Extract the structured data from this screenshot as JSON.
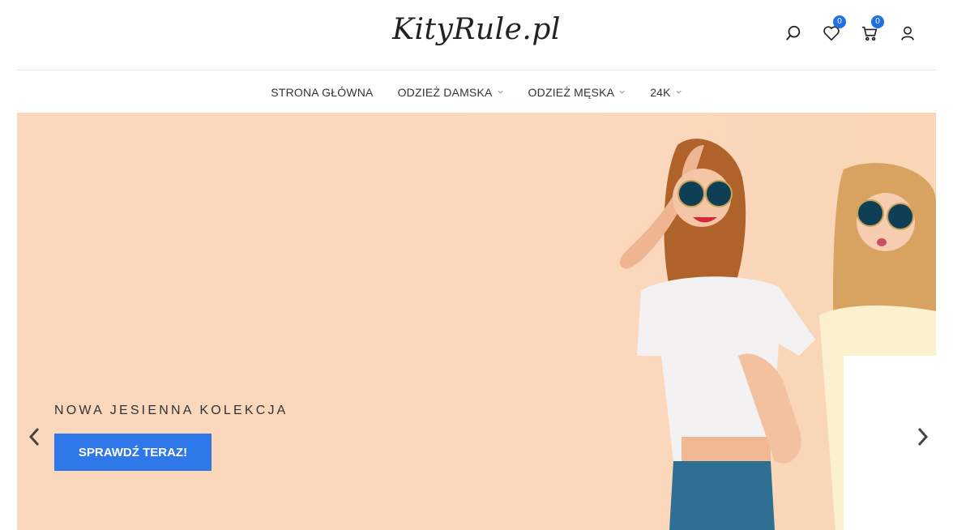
{
  "header": {
    "logo_text": "KityRule.pl",
    "wishlist_count": "0",
    "cart_count": "0"
  },
  "nav": {
    "items": [
      {
        "label": "STRONA GŁÓWNA",
        "dropdown": false
      },
      {
        "label": "ODZIEŻ DAMSKA",
        "dropdown": true
      },
      {
        "label": "ODZIEŻ MĘSKA",
        "dropdown": true
      },
      {
        "label": "24K",
        "dropdown": true
      }
    ]
  },
  "hero": {
    "kicker": "NOWA JESIENNA KOLEKCJA",
    "cta_label": "SPRAWDŹ TERAZ!"
  },
  "icons": {
    "search": "search-icon",
    "wishlist": "heart-icon",
    "cart": "cart-icon",
    "account": "user-icon",
    "prev": "chevron-left-icon",
    "next": "chevron-right-icon"
  },
  "colors": {
    "accent": "#2f78ea",
    "badge": "#1f6fe5",
    "hero_bg": "#fbd7bb"
  }
}
